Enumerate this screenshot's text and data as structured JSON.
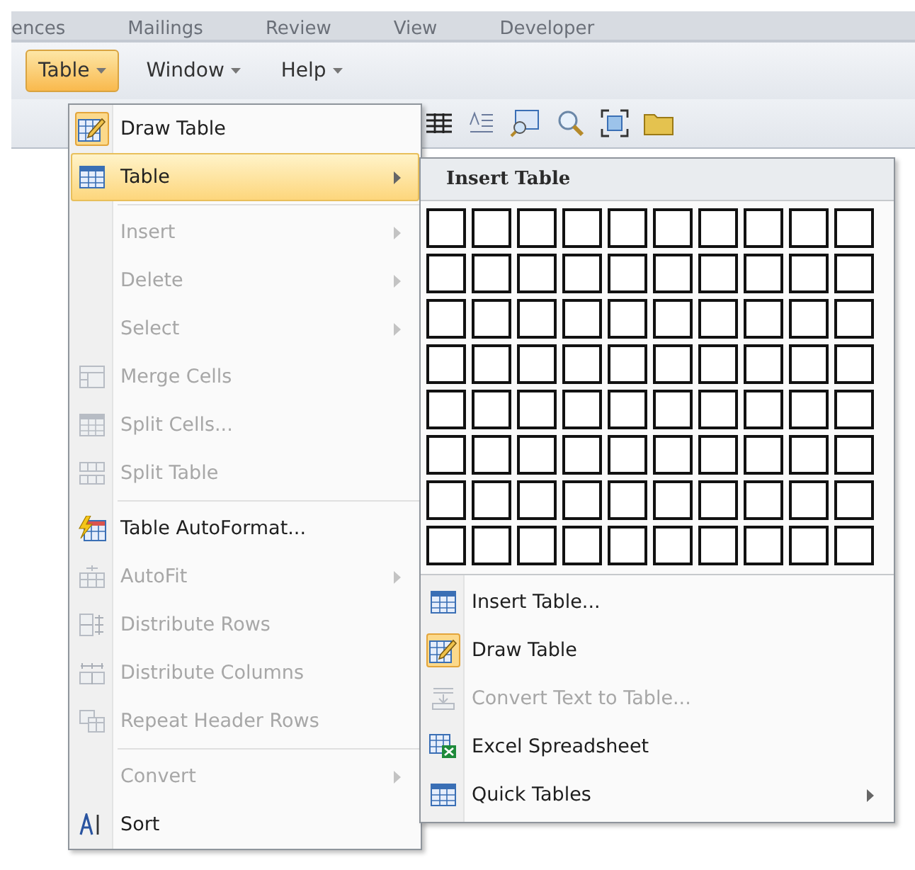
{
  "ribbon_tabs": [
    "ences",
    "Mailings",
    "Review",
    "View",
    "Developer"
  ],
  "menu_bar": [
    {
      "label": "Table",
      "selected": true
    },
    {
      "label": "Window",
      "selected": false
    },
    {
      "label": "Help",
      "selected": false
    }
  ],
  "table_menu": {
    "groups": [
      [
        {
          "label": "Draw Table",
          "kind": "draw-table",
          "checked": true,
          "selected": false,
          "disabled": false,
          "submenu": false
        },
        {
          "label": "Table",
          "kind": "grid",
          "checked": false,
          "selected": true,
          "disabled": false,
          "submenu": true
        }
      ],
      [
        {
          "label": "Insert",
          "kind": "plain",
          "checked": false,
          "selected": false,
          "disabled": true,
          "submenu": true
        },
        {
          "label": "Delete",
          "kind": "plain",
          "checked": false,
          "selected": false,
          "disabled": true,
          "submenu": true
        },
        {
          "label": "Select",
          "kind": "plain",
          "checked": false,
          "selected": false,
          "disabled": true,
          "submenu": true
        },
        {
          "label": "Merge Cells",
          "kind": "merge",
          "checked": false,
          "selected": false,
          "disabled": true,
          "submenu": false
        },
        {
          "label": "Split Cells...",
          "kind": "split-cells",
          "checked": false,
          "selected": false,
          "disabled": true,
          "submenu": false
        },
        {
          "label": "Split Table",
          "kind": "split-table",
          "checked": false,
          "selected": false,
          "disabled": true,
          "submenu": false
        }
      ],
      [
        {
          "label": "Table AutoFormat...",
          "kind": "autoformat",
          "checked": false,
          "selected": false,
          "disabled": false,
          "submenu": false
        },
        {
          "label": "AutoFit",
          "kind": "autofit",
          "checked": false,
          "selected": false,
          "disabled": true,
          "submenu": true
        },
        {
          "label": "Distribute Rows",
          "kind": "rows",
          "checked": false,
          "selected": false,
          "disabled": true,
          "submenu": false
        },
        {
          "label": "Distribute Columns",
          "kind": "columns",
          "checked": false,
          "selected": false,
          "disabled": true,
          "submenu": false
        },
        {
          "label": "Repeat Header Rows",
          "kind": "repeat",
          "checked": false,
          "selected": false,
          "disabled": true,
          "submenu": false
        }
      ],
      [
        {
          "label": "Convert",
          "kind": "plain",
          "checked": false,
          "selected": false,
          "disabled": true,
          "submenu": true
        },
        {
          "label": "Sort",
          "kind": "sort",
          "checked": false,
          "selected": false,
          "disabled": false,
          "submenu": false
        }
      ]
    ]
  },
  "insert_table_submenu": {
    "title": "Insert Table",
    "grid": [
      {
        "cells": [
          {
            "selected": false
          },
          {
            "selected": false
          },
          {
            "selected": false
          },
          {
            "selected": false
          },
          {
            "selected": false
          },
          {
            "selected": false
          },
          {
            "selected": false
          },
          {
            "selected": false
          },
          {
            "selected": false
          },
          {
            "selected": false
          }
        ]
      },
      {
        "cells": [
          {
            "selected": false
          },
          {
            "selected": false
          },
          {
            "selected": false
          },
          {
            "selected": false
          },
          {
            "selected": false
          },
          {
            "selected": false
          },
          {
            "selected": false
          },
          {
            "selected": false
          },
          {
            "selected": false
          },
          {
            "selected": false
          }
        ]
      },
      {
        "cells": [
          {
            "selected": false
          },
          {
            "selected": false
          },
          {
            "selected": false
          },
          {
            "selected": false
          },
          {
            "selected": false
          },
          {
            "selected": false
          },
          {
            "selected": false
          },
          {
            "selected": false
          },
          {
            "selected": false
          },
          {
            "selected": false
          }
        ]
      },
      {
        "cells": [
          {
            "selected": false
          },
          {
            "selected": false
          },
          {
            "selected": false
          },
          {
            "selected": false
          },
          {
            "selected": false
          },
          {
            "selected": false
          },
          {
            "selected": false
          },
          {
            "selected": false
          },
          {
            "selected": false
          },
          {
            "selected": false
          }
        ]
      },
      {
        "cells": [
          {
            "selected": false
          },
          {
            "selected": false
          },
          {
            "selected": false
          },
          {
            "selected": false
          },
          {
            "selected": false
          },
          {
            "selected": false
          },
          {
            "selected": false
          },
          {
            "selected": false
          },
          {
            "selected": false
          },
          {
            "selected": false
          }
        ]
      },
      {
        "cells": [
          {
            "selected": false
          },
          {
            "selected": false
          },
          {
            "selected": false
          },
          {
            "selected": false
          },
          {
            "selected": false
          },
          {
            "selected": false
          },
          {
            "selected": false
          },
          {
            "selected": false
          },
          {
            "selected": false
          },
          {
            "selected": false
          }
        ]
      },
      {
        "cells": [
          {
            "selected": false
          },
          {
            "selected": false
          },
          {
            "selected": false
          },
          {
            "selected": false
          },
          {
            "selected": false
          },
          {
            "selected": false
          },
          {
            "selected": false
          },
          {
            "selected": false
          },
          {
            "selected": false
          },
          {
            "selected": false
          }
        ]
      },
      {
        "cells": [
          {
            "selected": false
          },
          {
            "selected": false
          },
          {
            "selected": false
          },
          {
            "selected": false
          },
          {
            "selected": false
          },
          {
            "selected": false
          },
          {
            "selected": false
          },
          {
            "selected": false
          },
          {
            "selected": false
          },
          {
            "selected": false
          }
        ]
      }
    ],
    "items": [
      {
        "label": "Insert Table...",
        "kind": "grid",
        "checked": false,
        "disabled": false,
        "submenu": false
      },
      {
        "label": "Draw Table",
        "kind": "draw-table",
        "checked": true,
        "disabled": false,
        "submenu": false
      },
      {
        "label": "Convert Text to Table...",
        "kind": "convert",
        "checked": false,
        "disabled": true,
        "submenu": false
      },
      {
        "label": "Excel Spreadsheet",
        "kind": "excel",
        "checked": false,
        "disabled": false,
        "submenu": false
      },
      {
        "label": "Quick Tables",
        "kind": "grid",
        "checked": false,
        "disabled": false,
        "submenu": true
      }
    ]
  }
}
